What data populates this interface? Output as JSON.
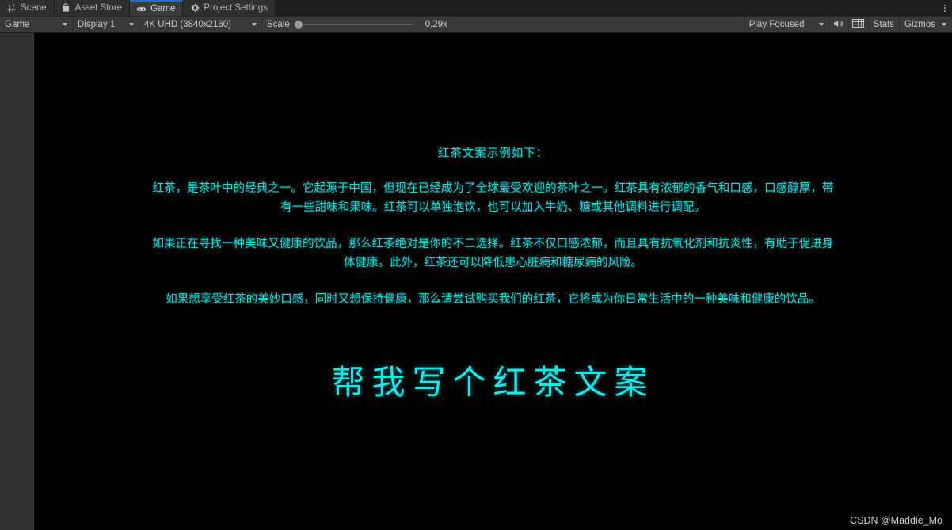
{
  "window": {
    "tabs": [
      {
        "label": "Scene",
        "icon": "grid-icon",
        "active": false
      },
      {
        "label": "Asset Store",
        "icon": "store-bag-icon",
        "active": false
      },
      {
        "label": "Game",
        "icon": "gamepad-icon",
        "active": true
      },
      {
        "label": "Project Settings",
        "icon": "gear-icon",
        "active": false
      }
    ],
    "overflow_menu": "kebab-menu-icon"
  },
  "toolbar": {
    "view_mode": "Game",
    "display": "Display 1",
    "resolution": "4K UHD (3840x2160)",
    "scale_label": "Scale",
    "scale_value": "0.29x",
    "play_mode": "Play Focused",
    "mute_audio_icon": "speaker-icon",
    "aspect_icon": "grid-overlay-icon",
    "stats": "Stats",
    "gizmos": "Gizmos"
  },
  "game": {
    "title": "红茶文案示例如下：",
    "paragraphs": [
      "红茶，是茶叶中的经典之一。它起源于中国，但现在已经成为了全球最受欢迎的茶叶之一。红茶具有浓郁的香气和口感，口感醇厚，带有一些甜味和果味。红茶可以单独泡饮，也可以加入牛奶、糖或其他调料进行调配。",
      "如果正在寻找一种美味又健康的饮品，那么红茶绝对是你的不二选择。红茶不仅口感浓郁，而且具有抗氧化剂和抗炎性，有助于促进身体健康。此外，红茶还可以降低患心脏病和糖尿病的风险。",
      "如果想享受红茶的美妙口感，同时又想保持健康，那么请尝试购买我们的红茶，它将成为你日常生活中的一种美味和健康的饮品。"
    ],
    "headline": "帮我写个红茶文案",
    "text_color": "#15d8d8",
    "background_color": "#000000"
  },
  "watermark": "CSDN @Maddie_Mo"
}
